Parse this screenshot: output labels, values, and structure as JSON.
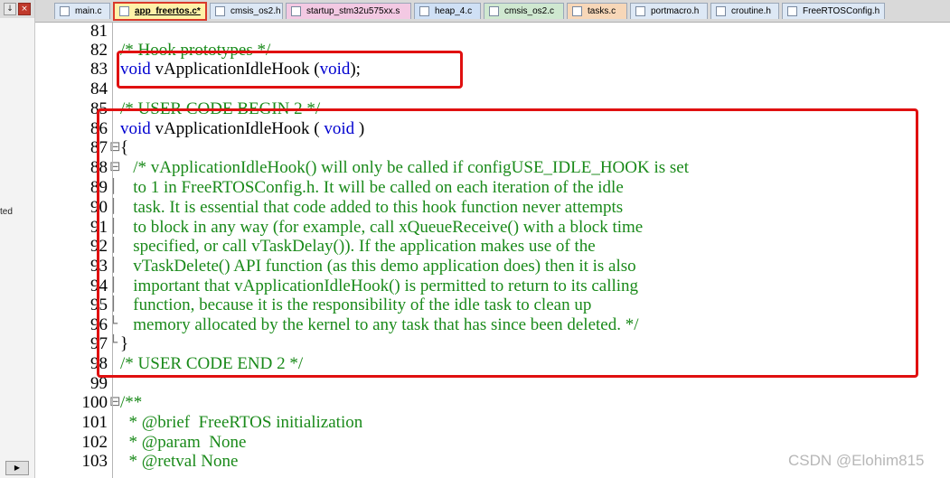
{
  "left_panel": {
    "pin_glyph": "↓",
    "close_glyph": "×",
    "clipped_text": "ted",
    "scroll_glyph": "▶"
  },
  "tabs": [
    {
      "label": "main.c",
      "active": false,
      "color": "#dde8f5"
    },
    {
      "label": "app_freertos.c*",
      "active": true,
      "color": "#fff2a8"
    },
    {
      "label": "cmsis_os2.h",
      "active": false,
      "color": "#dde8f5"
    },
    {
      "label": "startup_stm32u575xx.s",
      "active": false,
      "color": "#f3c9e3"
    },
    {
      "label": "heap_4.c",
      "active": false,
      "color": "#cfe0f5"
    },
    {
      "label": "cmsis_os2.c",
      "active": false,
      "color": "#cfe8d0"
    },
    {
      "label": "tasks.c",
      "active": false,
      "color": "#f7d7b8"
    },
    {
      "label": "portmacro.h",
      "active": false,
      "color": "#dde8f5"
    },
    {
      "label": "croutine.h",
      "active": false,
      "color": "#dde8f5"
    },
    {
      "label": "FreeRTOSConfig.h",
      "active": false,
      "color": "#dde8f5"
    }
  ],
  "editor": {
    "lines": [
      {
        "number": "81",
        "fold": "",
        "segments": []
      },
      {
        "number": "82",
        "fold": "",
        "segments": [
          {
            "text": "/* Hook prototypes */",
            "cls": "cm"
          }
        ]
      },
      {
        "number": "83",
        "fold": "",
        "segments": [
          {
            "text": "void",
            "cls": "kw"
          },
          {
            "text": " vApplicationIdleHook (",
            "cls": ""
          },
          {
            "text": "void",
            "cls": "kw"
          },
          {
            "text": ");",
            "cls": ""
          }
        ]
      },
      {
        "number": "84",
        "fold": "",
        "segments": []
      },
      {
        "number": "85",
        "fold": "",
        "segments": [
          {
            "text": "/* USER CODE BEGIN 2 */",
            "cls": "cm"
          }
        ]
      },
      {
        "number": "86",
        "fold": "",
        "segments": [
          {
            "text": "void",
            "cls": "kw"
          },
          {
            "text": " vApplicationIdleHook ( ",
            "cls": ""
          },
          {
            "text": "void",
            "cls": "kw"
          },
          {
            "text": " )",
            "cls": ""
          }
        ]
      },
      {
        "number": "87",
        "fold": "⊟",
        "segments": [
          {
            "text": "{",
            "cls": ""
          }
        ]
      },
      {
        "number": "88",
        "fold": "⊟",
        "segments": [
          {
            "text": "   /* vApplicationIdleHook() will only be called if configUSE_IDLE_HOOK is set",
            "cls": "cm"
          }
        ]
      },
      {
        "number": "89",
        "fold": "│",
        "segments": [
          {
            "text": "   to 1 in FreeRTOSConfig.h. It will be called on each iteration of the idle",
            "cls": "cm"
          }
        ]
      },
      {
        "number": "90",
        "fold": "│",
        "segments": [
          {
            "text": "   task. It is essential that code added to this hook function never attempts",
            "cls": "cm"
          }
        ]
      },
      {
        "number": "91",
        "fold": "│",
        "segments": [
          {
            "text": "   to block in any way (for example, call xQueueReceive() with a block time",
            "cls": "cm"
          }
        ]
      },
      {
        "number": "92",
        "fold": "│",
        "segments": [
          {
            "text": "   specified, or call vTaskDelay()). If the application makes use of the",
            "cls": "cm"
          }
        ]
      },
      {
        "number": "93",
        "fold": "│",
        "segments": [
          {
            "text": "   vTaskDelete() API function (as this demo application does) then it is also",
            "cls": "cm"
          }
        ]
      },
      {
        "number": "94",
        "fold": "│",
        "segments": [
          {
            "text": "   important that vApplicationIdleHook() is permitted to return to its calling",
            "cls": "cm"
          }
        ]
      },
      {
        "number": "95",
        "fold": "│",
        "segments": [
          {
            "text": "   function, because it is the responsibility of the idle task to clean up",
            "cls": "cm"
          }
        ]
      },
      {
        "number": "96",
        "fold": "└",
        "segments": [
          {
            "text": "   memory allocated by the kernel to any task that has since been deleted. */",
            "cls": "cm"
          }
        ]
      },
      {
        "number": "97",
        "fold": "└",
        "segments": [
          {
            "text": "}",
            "cls": ""
          }
        ]
      },
      {
        "number": "98",
        "fold": "",
        "segments": [
          {
            "text": "/* USER CODE END 2 */",
            "cls": "cm"
          }
        ]
      },
      {
        "number": "99",
        "fold": "",
        "segments": []
      },
      {
        "number": "100",
        "fold": "⊟",
        "segments": [
          {
            "text": "/**",
            "cls": "cm"
          }
        ]
      },
      {
        "number": "101",
        "fold": "",
        "segments": [
          {
            "text": "  * @brief  FreeRTOS initialization",
            "cls": "cm"
          }
        ]
      },
      {
        "number": "102",
        "fold": "",
        "segments": [
          {
            "text": "  * @param  None",
            "cls": "cm"
          }
        ]
      },
      {
        "number": "103",
        "fold": "",
        "segments": [
          {
            "text": "  * @retval None",
            "cls": "cm"
          }
        ]
      }
    ]
  },
  "watermark": "CSDN @Elohim815"
}
